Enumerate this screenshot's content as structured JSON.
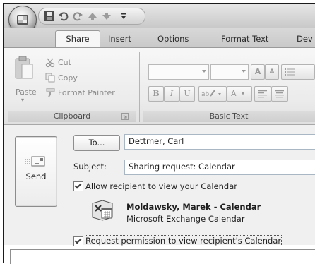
{
  "title_bar": {
    "qat_icons": [
      "save-icon",
      "undo-icon",
      "redo-icon",
      "up-arrow-icon",
      "down-arrow-icon",
      "customize-qat-icon"
    ]
  },
  "tabs": [
    {
      "label": "Share",
      "active": true
    },
    {
      "label": "Insert",
      "active": false
    },
    {
      "label": "Options",
      "active": false
    },
    {
      "label": "Format Text",
      "active": false
    },
    {
      "label": "Dev",
      "active": false
    }
  ],
  "ribbon": {
    "clipboard": {
      "group_label": "Clipboard",
      "paste_label": "Paste",
      "cut_label": "Cut",
      "copy_label": "Copy",
      "format_painter_label": "Format Painter"
    },
    "basic_text": {
      "group_label": "Basic Text",
      "bold": "B",
      "italic": "I",
      "underline": "U",
      "grow_font": "A",
      "shrink_font": "A",
      "font_color": "A"
    }
  },
  "form": {
    "send_label": "Send",
    "to_button_label": "To...",
    "to_value": "Dettmer, Carl",
    "subject_label": "Subject:",
    "subject_value": "Sharing request: Calendar",
    "allow_label": "Allow recipient to view your Calendar",
    "allow_checked": true,
    "calendar_name": "Moldawsky, Marek - Calendar",
    "calendar_source": "Microsoft Exchange Calendar",
    "request_label": "Request permission to view recipient's Calendar",
    "request_checked": true
  }
}
